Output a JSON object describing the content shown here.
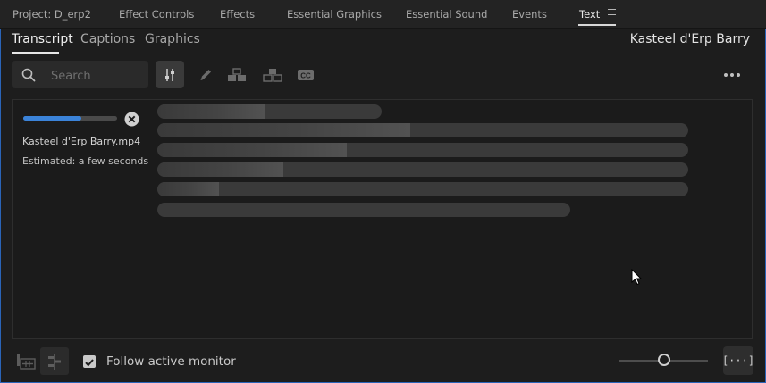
{
  "panel_tabs": [
    {
      "label": "Project: D_erp2"
    },
    {
      "label": "Effect Controls"
    },
    {
      "label": "Effects"
    },
    {
      "label": "Essential Graphics"
    },
    {
      "label": "Essential Sound"
    },
    {
      "label": "Events"
    },
    {
      "label": "Text",
      "active": true
    }
  ],
  "sub_tabs": [
    {
      "label": "Transcript",
      "active": true
    },
    {
      "label": "Captions"
    },
    {
      "label": "Graphics"
    }
  ],
  "clip_name": "Kasteel d'Erp Barry",
  "search": {
    "placeholder": "Search",
    "value": ""
  },
  "toolbar": {
    "icons": [
      "filter-sliders-icon",
      "pencil-icon",
      "merge-segments-icon",
      "split-segment-icon",
      "cc-icon",
      "more-icon"
    ]
  },
  "transcription": {
    "progress": 0.62,
    "file_name": "Kasteel d'Erp Barry.mp4",
    "estimate": "Estimated: a few seconds"
  },
  "colors": {
    "accent": "#3b83d9",
    "background": "#1d1d1d",
    "frame_border": "#2a64b8"
  },
  "bottom_bar": {
    "follow_label": "Follow active monitor",
    "follow_checked": true,
    "zoom_level": 0.5,
    "collapse_label": "[···]"
  }
}
